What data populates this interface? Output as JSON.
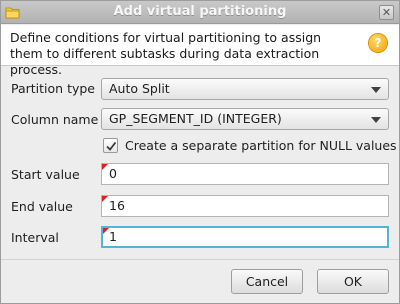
{
  "window": {
    "title": "Add virtual partitioning",
    "close_glyph": "✕",
    "app_icon": "folder-icon"
  },
  "header": {
    "description": "Define conditions for virtual partitioning to assign them to different subtasks during data extraction process.",
    "help_glyph": "?"
  },
  "form": {
    "partition_type": {
      "label": "Partition type",
      "value": "Auto Split"
    },
    "column_name": {
      "label": "Column name",
      "value": "GP_SEGMENT_ID (INTEGER)"
    },
    "null_partition": {
      "label": "Create a separate partition for NULL values",
      "checked": true
    },
    "start_value": {
      "label": "Start value",
      "value": "0"
    },
    "end_value": {
      "label": "End value",
      "value": "16"
    },
    "interval": {
      "label": "Interval",
      "value": "1"
    }
  },
  "buttons": {
    "cancel": "Cancel",
    "ok": "OK"
  },
  "colors": {
    "focus_border": "#56b3d8",
    "required_marker": "#e02020",
    "help_icon": "#f2a100"
  }
}
